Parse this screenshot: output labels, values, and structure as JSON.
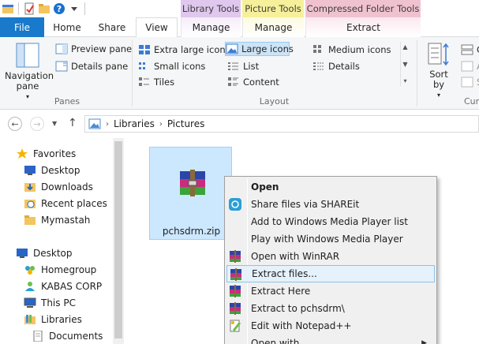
{
  "context_tab_headers": {
    "library_tools": "Library Tools",
    "picture_tools": "Picture Tools",
    "compressed_folder_tools": "Compressed Folder Tools"
  },
  "tabs": {
    "file": "File",
    "home": "Home",
    "share": "Share",
    "view": "View",
    "library_manage": "Manage",
    "picture_manage": "Manage",
    "extract": "Extract"
  },
  "ribbon": {
    "panes": {
      "navigation_pane": "Navigation pane",
      "preview_pane": "Preview pane",
      "details_pane": "Details pane",
      "group_label": "Panes"
    },
    "layout": {
      "extra_large_icons": "Extra large icons",
      "large_icons": "Large icons",
      "medium_icons": "Medium icons",
      "small_icons": "Small icons",
      "list": "List",
      "details": "Details",
      "tiles": "Tiles",
      "content": "Content",
      "group_label": "Layout"
    },
    "current_view": {
      "sort_by": "Sort by",
      "group_label_partial": "Cur",
      "partial_items": [
        "G",
        "Ad",
        "Si"
      ]
    }
  },
  "address": {
    "crumbs": [
      "Libraries",
      "Pictures"
    ]
  },
  "nav_pane": {
    "items": [
      {
        "label": "Favorites",
        "icon": "star-icon"
      },
      {
        "label": "Desktop",
        "icon": "desktop-icon"
      },
      {
        "label": "Downloads",
        "icon": "downloads-icon"
      },
      {
        "label": "Recent places",
        "icon": "recent-places-icon"
      },
      {
        "label": "Mymastah",
        "icon": "folder-icon"
      },
      {
        "label": "Desktop",
        "icon": "desktop-icon"
      },
      {
        "label": "Homegroup",
        "icon": "homegroup-icon"
      },
      {
        "label": "KABAS CORP",
        "icon": "user-icon"
      },
      {
        "label": "This PC",
        "icon": "computer-icon"
      },
      {
        "label": "Libraries",
        "icon": "libraries-icon"
      },
      {
        "label": "Documents",
        "icon": "documents-icon"
      }
    ]
  },
  "file": {
    "name": "pchsdrm.zip",
    "icon": "winrar-archive-icon"
  },
  "context_menu": {
    "items": [
      {
        "label": "Open",
        "icon": "",
        "bold": true
      },
      {
        "label": "Share files via SHAREit",
        "icon": "shareit-icon"
      },
      {
        "label": "Add to Windows Media Player list",
        "icon": ""
      },
      {
        "label": "Play with Windows Media Player",
        "icon": ""
      },
      {
        "label": "Open with WinRAR",
        "icon": "winrar-icon"
      },
      {
        "label": "Extract files...",
        "icon": "winrar-icon",
        "highlighted": true
      },
      {
        "label": "Extract Here",
        "icon": "winrar-icon"
      },
      {
        "label": "Extract to pchsdrm\\",
        "icon": "winrar-icon"
      },
      {
        "label": "Edit with Notepad++",
        "icon": "notepad-plus-plus-icon"
      },
      {
        "label": "Open with",
        "icon": "",
        "submenu": true
      }
    ]
  },
  "colors": {
    "file_tab": "#1979ca",
    "library_tools": "#dfc7ed",
    "picture_tools": "#f6f09a",
    "compressed_folder_tools": "#f0c2d0",
    "selection": "#cce8ff"
  }
}
